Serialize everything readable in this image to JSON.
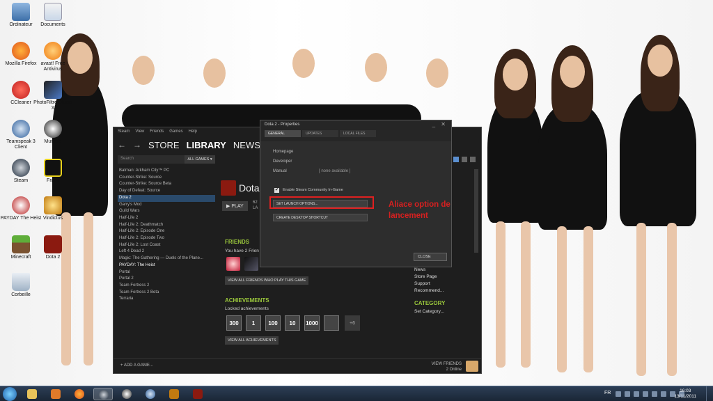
{
  "desktop": {
    "icons": [
      {
        "label": "Ordinateur"
      },
      {
        "label": "Documents"
      },
      {
        "label": "Mozilla Firefox"
      },
      {
        "label": "avast! Free Antivirus"
      },
      {
        "label": "CCleaner"
      },
      {
        "label": "PhotoFiltre Studio X"
      },
      {
        "label": "Teamspeak 3 Client"
      },
      {
        "label": "Mumble"
      },
      {
        "label": "Steam"
      },
      {
        "label": "Fraps"
      },
      {
        "label": "PAYDAY The Heist"
      },
      {
        "label": "Vindictus"
      },
      {
        "label": "Minecraft"
      },
      {
        "label": "Dota 2"
      },
      {
        "label": "Corbeille"
      }
    ]
  },
  "steam": {
    "menu": [
      "Steam",
      "View",
      "Friends",
      "Games",
      "Help"
    ],
    "nav": {
      "back": "←",
      "forward": "→",
      "store": "STORE",
      "library": "LIBRARY",
      "news": "NEWS",
      "community_partial": "C"
    },
    "search_placeholder": "Search",
    "all_games_label": "ALL GAMES ▾",
    "games": [
      "Batman: Arkham City™ PC",
      "Counter-Strike: Source",
      "Counter-Strike: Source Beta",
      "Day of Defeat: Source",
      "Dota 2",
      "Garry's Mod",
      "Guild Wars",
      "Half-Life 2",
      "Half-Life 2: Deathmatch",
      "Half-Life 2: Episode One",
      "Half-Life 2: Episode Two",
      "Half-Life 2: Lost Coast",
      "Left 4 Dead 2",
      "Magic: The Gathering — Duels of the Plane...",
      "PAYDAY: The Heist",
      "Portal",
      "Portal 2",
      "Team Fortress 2",
      "Team Fortress 2 Beta",
      "Terraria"
    ],
    "selected_game": "Dota 2",
    "detail": {
      "game_title": "Dota",
      "play_label": "▶ PLAY",
      "play_info_1": "62",
      "play_info_2": "LA",
      "friends_heading": "FRIENDS",
      "friends_sub": "You have 2 Frien",
      "view_friends_button": "VIEW ALL FRIENDS WHO PLAY THIS GAME",
      "achievements_heading": "ACHIEVEMENTS",
      "achievements_sub": "Locked achievements",
      "achievement_badges": [
        "300",
        "1",
        "100",
        "10",
        "1000",
        "",
        "+6"
      ],
      "view_achievements_button": "VIEW ALL ACHIEVEMENTS"
    },
    "links": {
      "news": "News",
      "store_page": "Store Page",
      "support": "Support",
      "recommend": "Recommend...",
      "category_heading": "CATEGORY",
      "set_category": "Set Category..."
    },
    "footer": {
      "add_game": "+ ADD A GAME...",
      "view_friends": "VIEW FRIENDS",
      "online_count": "2 Online"
    }
  },
  "properties": {
    "title": "Dota 2 - Properties",
    "controls": "_ ✕",
    "tabs": [
      "GENERAL",
      "UPDATES",
      "LOCAL FILES"
    ],
    "homepage_label": "Homepage",
    "developer_label": "Developer",
    "manual_label": "Manual",
    "manual_value": "[ none available ]",
    "community_checkbox_label": "Enable Steam Community In-Game",
    "launch_options_button": "SET LAUNCH OPTIONS...",
    "desktop_shortcut_button": "CREATE DESKTOP SHORTCUT",
    "close_button": "CLOSE"
  },
  "annotation": {
    "line1": "Aliace option de",
    "line2": "lancement",
    "color": "#d62020"
  },
  "taskbar": {
    "language": "FR",
    "time": "16:03",
    "date": "13/11/2011"
  }
}
